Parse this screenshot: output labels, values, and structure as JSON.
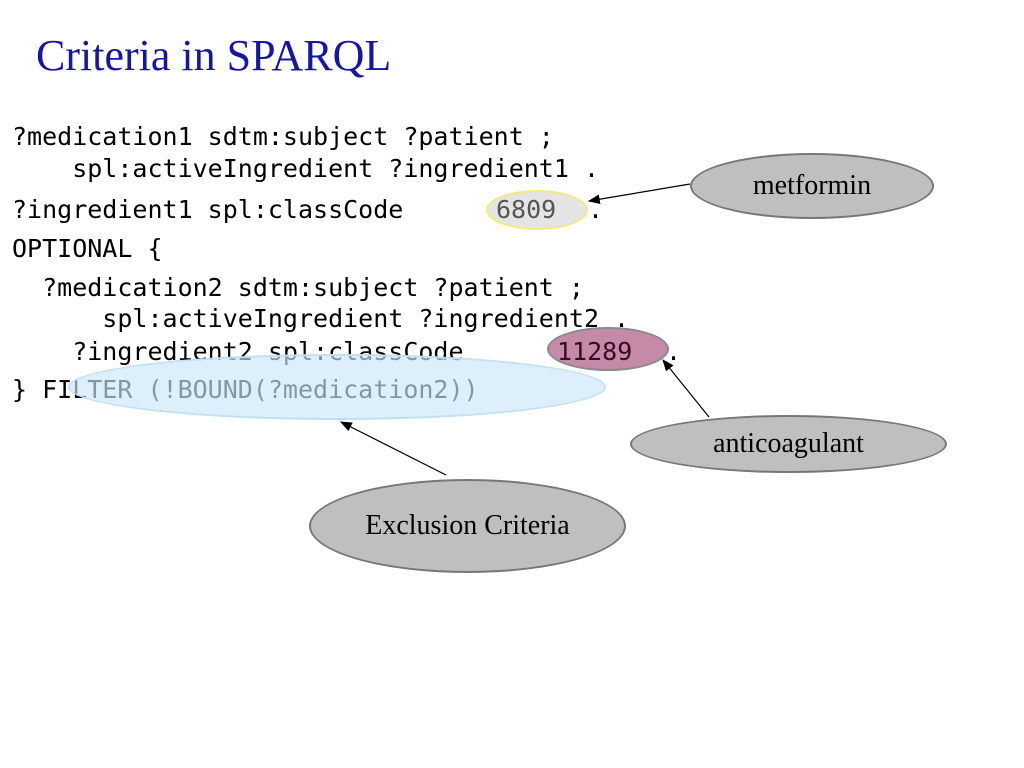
{
  "slide": {
    "title": "Criteria in SPARQL",
    "code_lines": [
      "?medication1 sdtm:subject ?patient ;",
      "    spl:activeIngredient ?ingredient1 .",
      "?ingredient1 spl:classCode",
      "6809",
      ".",
      "OPTIONAL {",
      "  ?medication2 sdtm:subject ?patient ;",
      "      spl:activeIngredient ?ingredient2 .",
      "    ?ingredient2 spl:classCode",
      "11289",
      ".",
      "} FILTER (!BOUND(?medication2))"
    ],
    "callouts": {
      "metformin": "metformin",
      "anticoagulant": "anticoagulant",
      "exclusion": "Exclusion Criteria"
    },
    "colors": {
      "title": "#1616a6",
      "callout_fill": "#bfbfbf",
      "highlight_6809": "#e4e4e4",
      "highlight_11289": "#c48aa7",
      "highlight_filter": "#cde7fa"
    }
  }
}
